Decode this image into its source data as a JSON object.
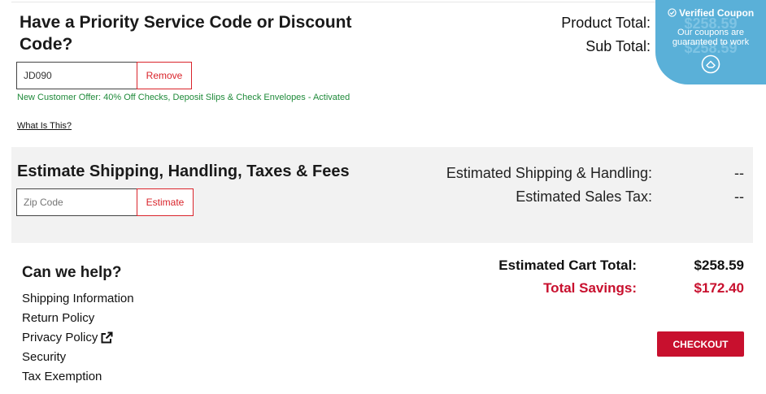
{
  "promo": {
    "title": "Have a Priority Service Code or Discount Code?",
    "code_value": "JD090",
    "remove_label": "Remove",
    "offer_text": "New Customer Offer: 40% Off Checks, Deposit Slips & Check Envelopes - Activated",
    "what_is_this": "What Is This?"
  },
  "totals": {
    "product_total_label": "Product Total:",
    "sub_total_label": "Sub Total:"
  },
  "badge": {
    "title": "Verified Coupon",
    "subtitle": "Our coupons are guaranteed to work",
    "value_1": "$258.59",
    "value_2": "$258.59",
    "icon": "coupon-logo-icon"
  },
  "shipping": {
    "title": "Estimate Shipping, Handling, Taxes & Fees",
    "zip_placeholder": "Zip Code",
    "estimate_label": "Estimate",
    "handling_label": "Estimated Shipping & Handling:",
    "handling_value": "--",
    "tax_label": "Estimated Sales Tax:",
    "tax_value": "--"
  },
  "help": {
    "title": "Can we help?",
    "links": [
      "Shipping Information",
      "Return Policy",
      "Privacy Policy",
      "Security",
      "Tax Exemption"
    ]
  },
  "summary": {
    "cart_total_label": "Estimated Cart Total:",
    "cart_total_value": "$258.59",
    "savings_label": "Total Savings:",
    "savings_value": "$172.40",
    "checkout_label": "CHECKOUT"
  },
  "colors": {
    "accent_red": "#c8102e",
    "offer_green": "#1f8a3a",
    "badge_blue": "#5ab0d8"
  }
}
